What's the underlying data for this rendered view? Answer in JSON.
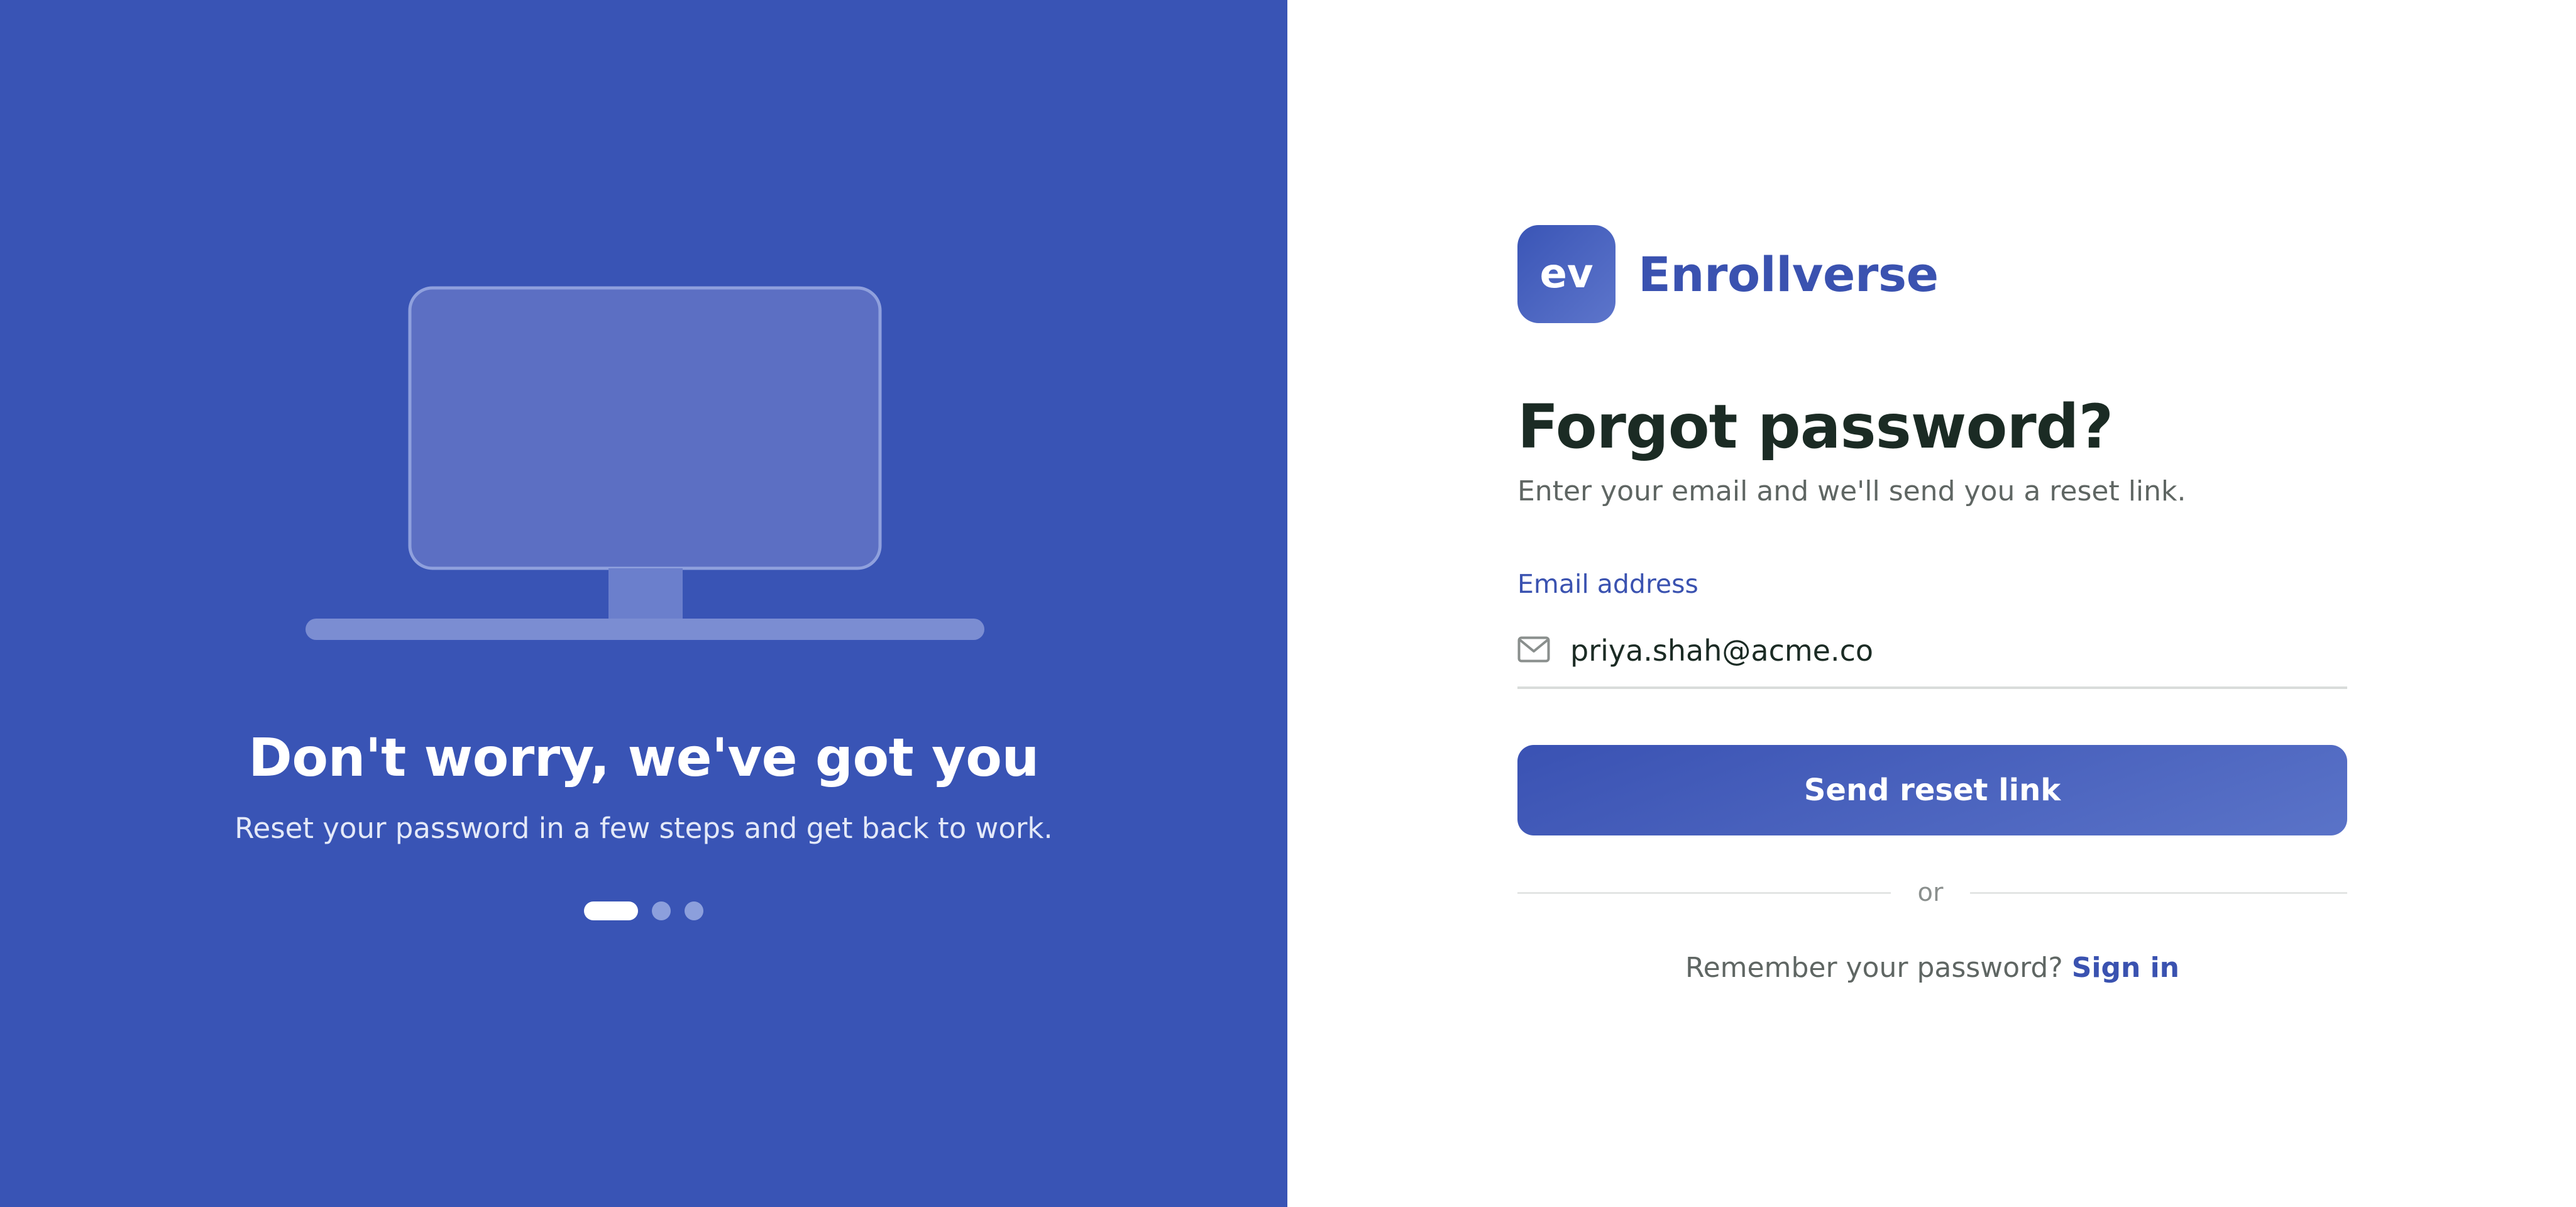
{
  "left_panel": {
    "illustration_icon": "monitor-icon",
    "title": "Don't worry, we've got you",
    "subtitle": "Reset your password in a few steps and get back to work.",
    "carousel": {
      "total_slides": 3,
      "active_slide": 1
    }
  },
  "brand": {
    "logo_text": "ev",
    "name": "Enrollverse"
  },
  "form": {
    "title": "Forgot password?",
    "subtitle": "Enter your email and we'll send you a reset link.",
    "email_label": "Email address",
    "email_icon": "mail-icon",
    "email_value": "priya.shah@acme.co",
    "submit_label": "Send reset link",
    "divider_text": "or",
    "signin_prompt": "Remember your password?",
    "signin_link": "Sign in"
  },
  "colors": {
    "left_panel_background": "#3954b5",
    "accent": "#3a52b0",
    "heading_text": "#1b2b24",
    "muted_text": "#5f6663",
    "page_background": "#ffffff"
  }
}
